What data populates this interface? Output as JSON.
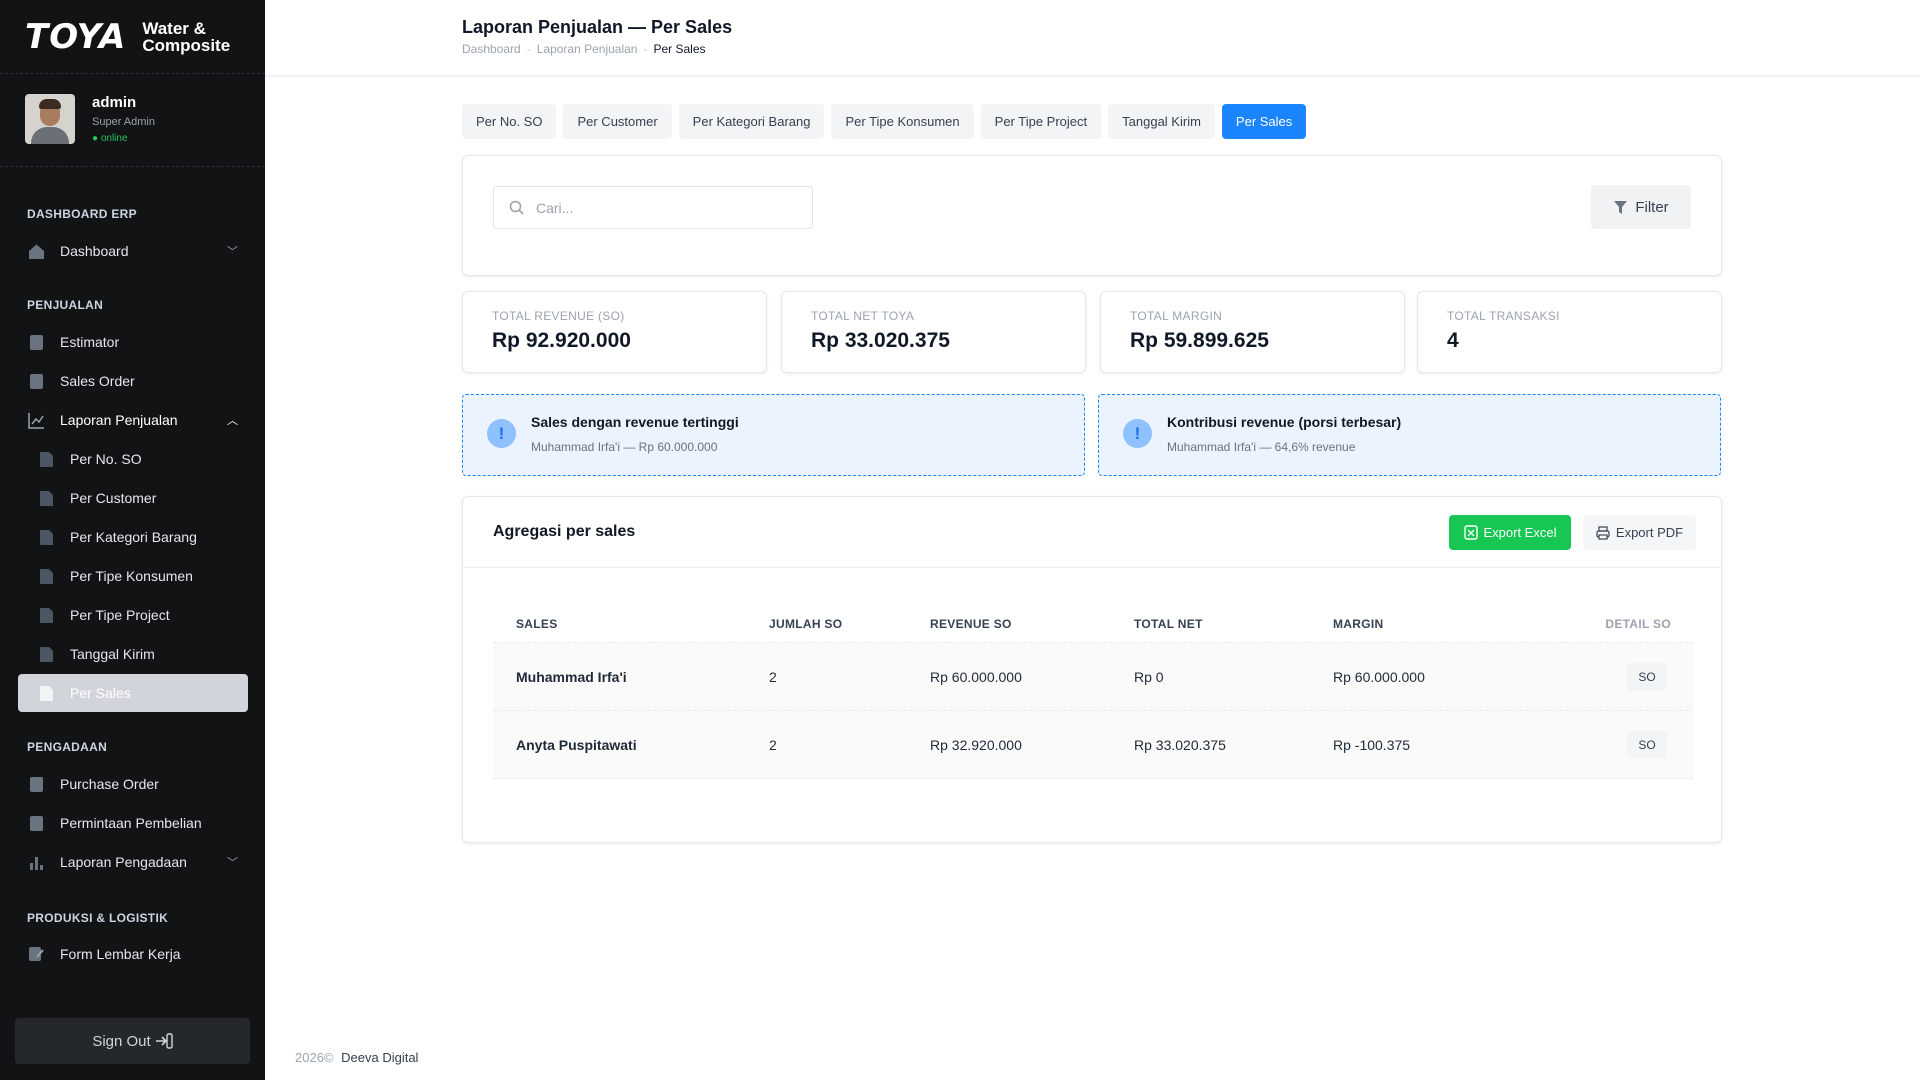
{
  "brand": {
    "logo": "TOYA",
    "sub1": "Water &",
    "sub2": "Composite"
  },
  "user": {
    "name": "admin",
    "role": "Super Admin",
    "status": "● online"
  },
  "sidebar": {
    "sections": [
      "DASHBOARD ERP",
      "PENJUALAN",
      "PENGADAAN",
      "PRODUKSI & LOGISTIK"
    ],
    "items": [
      {
        "label": "Dashboard"
      },
      {
        "label": "Estimator"
      },
      {
        "label": "Sales Order"
      },
      {
        "label": "Laporan Penjualan"
      },
      {
        "label": "Per No. SO"
      },
      {
        "label": "Per Customer"
      },
      {
        "label": "Per Kategori Barang"
      },
      {
        "label": "Per Tipe Konsumen"
      },
      {
        "label": "Per Tipe Project"
      },
      {
        "label": "Tanggal Kirim"
      },
      {
        "label": "Per Sales"
      },
      {
        "label": "Purchase Order"
      },
      {
        "label": "Permintaan Pembelian"
      },
      {
        "label": "Laporan Pengadaan"
      },
      {
        "label": "Form Lembar Kerja"
      }
    ],
    "signout": "Sign Out"
  },
  "header": {
    "title": "Laporan Penjualan — Per Sales",
    "breadcrumb": [
      "Dashboard",
      "Laporan Penjualan",
      "Per Sales"
    ]
  },
  "tabs": [
    "Per No. SO",
    "Per Customer",
    "Per Kategori Barang",
    "Per Tipe Konsumen",
    "Per Tipe Project",
    "Tanggal Kirim",
    "Per Sales"
  ],
  "search": {
    "placeholder": "Cari...",
    "value": ""
  },
  "filter_label": "Filter",
  "stats": [
    {
      "label": "TOTAL REVENUE (SO)",
      "value": "Rp 92.920.000"
    },
    {
      "label": "TOTAL NET TOYA",
      "value": "Rp 33.020.375"
    },
    {
      "label": "TOTAL MARGIN",
      "value": "Rp 59.899.625"
    },
    {
      "label": "TOTAL TRANSAKSI",
      "value": "4"
    }
  ],
  "insights": [
    {
      "title": "Sales dengan revenue tertinggi",
      "sub": "Muhammad Irfa'i — Rp 60.000.000"
    },
    {
      "title": "Kontribusi revenue (porsi terbesar)",
      "sub": "Muhammad Irfa'i — 64,6% revenue"
    }
  ],
  "table": {
    "title": "Agregasi per sales",
    "export_excel": "Export Excel",
    "export_pdf": "Export PDF",
    "columns": [
      "SALES",
      "JUMLAH SO",
      "REVENUE SO",
      "TOTAL NET",
      "MARGIN",
      "DETAIL SO"
    ],
    "rows": [
      [
        "Muhammad Irfa'i",
        "2",
        "Rp 60.000.000",
        "Rp 0",
        "Rp 60.000.000",
        "SO"
      ],
      [
        "Anyta Puspitawati",
        "2",
        "Rp 32.920.000",
        "Rp 33.020.375",
        "Rp -100.375",
        "SO"
      ]
    ]
  },
  "footer": {
    "year": "2026©",
    "company": "Deeva Digital"
  },
  "colors": {
    "accent": "#1b84ff",
    "success": "#17c653",
    "sidebar": "#111315"
  }
}
